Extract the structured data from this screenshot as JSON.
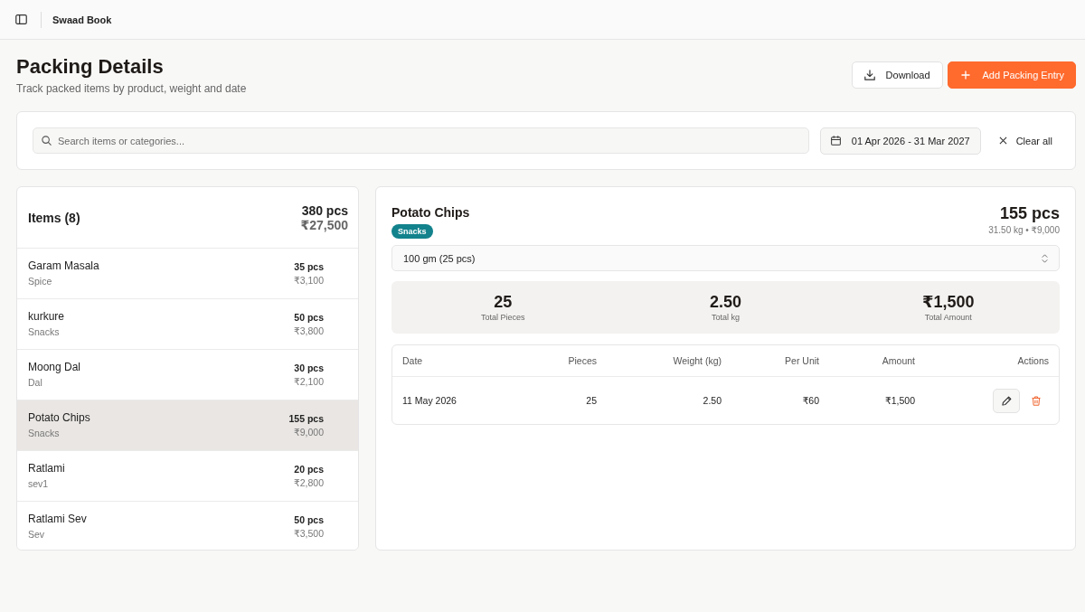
{
  "topbar": {
    "title": "Swaad Book"
  },
  "header": {
    "title": "Packing Details",
    "subtitle": "Track packed items by product, weight and date",
    "buttons": [
      {
        "label": "Download",
        "kind": "secondary"
      },
      {
        "label": "Add Packing Entry",
        "kind": "primary"
      }
    ]
  },
  "filters": {
    "search": {
      "placeholder": "Search items or categories..."
    },
    "date_range": "01 Apr 2026 - 31 Mar 2027",
    "clear": "Clear all"
  },
  "items_panel": {
    "title": "Items (8)",
    "total_pieces": "380 pcs",
    "total_amount": "₹27,500",
    "items": [
      {
        "name": "Garam Masala",
        "category": "Spice",
        "pieces": "35 pcs",
        "amount": "₹3,100",
        "selected": false
      },
      {
        "name": "kurkure",
        "category": "Snacks",
        "pieces": "50 pcs",
        "amount": "₹3,800",
        "selected": false
      },
      {
        "name": "Moong Dal",
        "category": "Dal",
        "pieces": "30 pcs",
        "amount": "₹2,100",
        "selected": false
      },
      {
        "name": "Potato Chips",
        "category": "Snacks",
        "pieces": "155 pcs",
        "amount": "₹9,000",
        "selected": true
      },
      {
        "name": "Ratlami",
        "category": "sev1",
        "pieces": "20 pcs",
        "amount": "₹2,800",
        "selected": false
      },
      {
        "name": "Ratlami Sev",
        "category": "Sev",
        "pieces": "50 pcs",
        "amount": "₹3,500",
        "selected": false
      }
    ]
  },
  "detail": {
    "name": "Potato Chips",
    "tag": "Snacks",
    "pieces": "155 pcs",
    "summary": "31.50 kg • ₹9,000",
    "pack_size": "100 gm (25 pcs)",
    "stats": [
      {
        "value": "25",
        "label": "Total Pieces"
      },
      {
        "value": "2.50",
        "label": "Total kg"
      },
      {
        "value": "₹1,500",
        "label": "Total Amount"
      }
    ],
    "table": {
      "columns": [
        "Date",
        "Pieces",
        "Weight (kg)",
        "Per Unit",
        "Amount",
        "Actions"
      ],
      "rows": [
        {
          "cells": [
            "11 May 2026",
            "25",
            "2.50",
            "₹60",
            "₹1,500"
          ]
        }
      ]
    }
  }
}
